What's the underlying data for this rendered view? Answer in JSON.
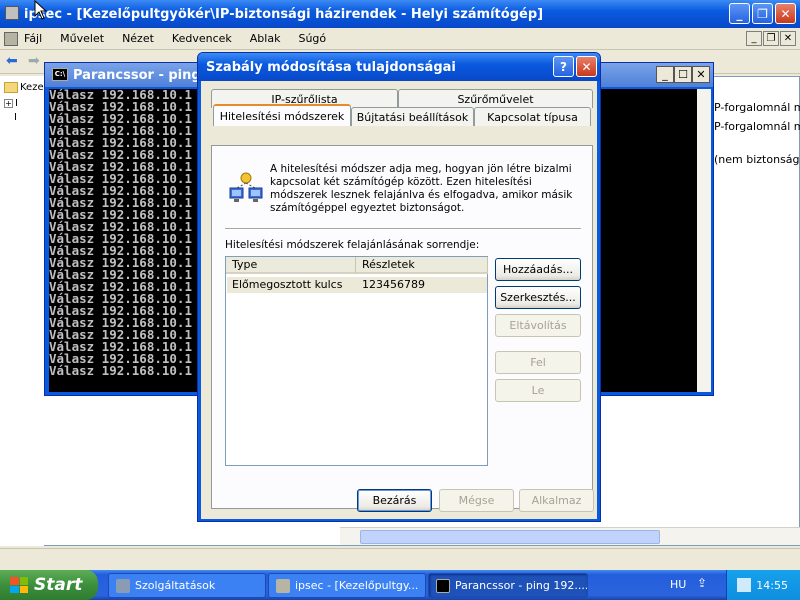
{
  "mmc": {
    "title": "ipsec - [Kezelőpultgyökér\\IP-biztonsági házirendek - Helyi számítógép]",
    "menu": [
      "Fájl",
      "Művelet",
      "Nézet",
      "Kedvencek",
      "Ablak",
      "Súgó"
    ],
    "tree_items": [
      "Keze",
      "I",
      "I"
    ],
    "right_pane_lines": [
      "P-forgalomnál min",
      "P-forgalomnál min",
      "(nem biztonságos"
    ]
  },
  "cmd": {
    "title": "Parancssor - ping 1",
    "lines": [
      "Válasz 192.168.10.1",
      "Válasz 192.168.10.1",
      "Válasz 192.168.10.1",
      "Válasz 192.168.10.1",
      "Válasz 192.168.10.1",
      "Válasz 192.168.10.1",
      "Válasz 192.168.10.1",
      "Válasz 192.168.10.1",
      "Válasz 192.168.10.1",
      "Válasz 192.168.10.1",
      "Válasz 192.168.10.1",
      "Válasz 192.168.10.1",
      "Válasz 192.168.10.1",
      "Válasz 192.168.10.1",
      "Válasz 192.168.10.1",
      "Válasz 192.168.10.1",
      "Válasz 192.168.10.1",
      "Válasz 192.168.10.1",
      "Válasz 192.168.10.1",
      "Válasz 192.168.10.1",
      "Válasz 192.168.10.1",
      "Válasz 192.168.10.1",
      "Válasz 192.168.10.1",
      "Válasz 192.168.10.1"
    ]
  },
  "dialog": {
    "title": "Szabály módosítása tulajdonságai",
    "help_label": "?",
    "close_label": "✕",
    "tabs_row1": [
      "IP-szűrőlista",
      "Szűrőművelet"
    ],
    "tabs_row2": [
      "Hitelesítési módszerek",
      "Bújtatási beállítások",
      "Kapcsolat típusa"
    ],
    "description": "A hitelesítési módszer adja meg, hogyan jön létre bizalmi kapcsolat két számítógép között. Ezen hitelesítési módszerek lesznek felajánlva és elfogadva, amikor másik számítógéppel egyeztet biztonságot.",
    "list_label": "Hitelesítési módszerek felajánlásának sorrendje:",
    "columns": [
      "Type",
      "Részletek"
    ],
    "rows": [
      {
        "type": "Előmegosztott kulcs",
        "details": "123456789"
      }
    ],
    "buttons": {
      "add": "Hozzáadás...",
      "edit": "Szerkesztés...",
      "remove": "Eltávolítás",
      "up": "Fel",
      "down": "Le",
      "close": "Bezárás",
      "cancel": "Mégse",
      "apply": "Alkalmaz"
    }
  },
  "taskbar": {
    "start": "Start",
    "tasks": [
      "Szolgáltatások",
      "ipsec - [Kezelőpultgy...",
      "Parancssor - ping 192...."
    ],
    "language": "HU",
    "clock": "14:55"
  }
}
